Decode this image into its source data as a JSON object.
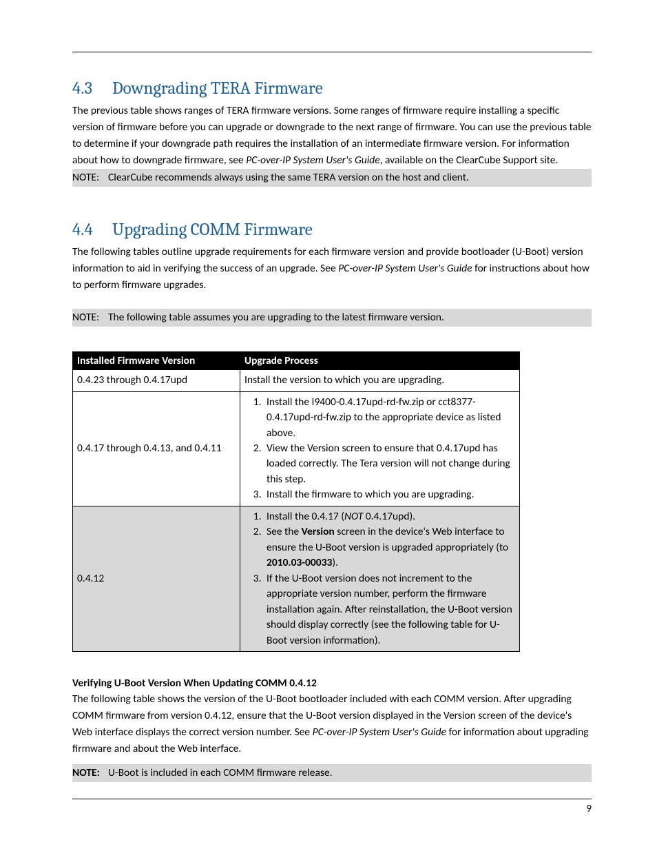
{
  "section43": {
    "num": "4.3",
    "title": "Downgrading TERA Firmware",
    "para_a": "The previous table shows ranges of TERA firmware versions. Some ranges of firmware require installing a specific version of firmware before you can upgrade or downgrade to the next range of firmware. You can use the previous table to determine if your downgrade path requires the installation of an intermediate firmware version. For information about how to downgrade firmware, see ",
    "para_a_italic": "PC-over-IP System User's Guide",
    "para_a_tail": ", available on the ClearCube Support site.",
    "note_label": "NOTE:",
    "note_text": "ClearCube recommends always using the same TERA version on the host and client."
  },
  "section44": {
    "num": "4.4",
    "title": "Upgrading COMM Firmware",
    "para_a": "The following tables outline upgrade requirements for each firmware version and provide bootloader (U-Boot) version information to aid in verifying the success of an upgrade. See ",
    "para_a_italic": "PC-over-IP System User's Guide",
    "para_a_tail": " for instructions about how to perform firmware upgrades.",
    "note_label": "NOTE:",
    "note_text": "The following table assumes you are upgrading to the latest firmware version."
  },
  "table": {
    "h1": "Installed Firmware Version",
    "h2": "Upgrade Process",
    "r1_ver": "0.4.23 through 0.4.17upd",
    "r1_proc": "Install the version to which you are upgrading.",
    "r2_ver": "0.4.17 through 0.4.13, and 0.4.11",
    "r2_s1": "Install the I9400-0.4.17upd-rd-fw.zip or cct8377-0.4.17upd-rd-fw.zip to the appropriate device as listed above.",
    "r2_s2": "View the Version screen to ensure that 0.4.17upd has loaded correctly.  The Tera version will not change during this step.",
    "r2_s3": "Install the firmware to which you are upgrading.",
    "r3_ver": "0.4.12",
    "r3_s1_a": "Install the 0.4.17 (",
    "r3_s1_i": "NOT",
    "r3_s1_b": " 0.4.17upd).",
    "r3_s2_a": "See the ",
    "r3_s2_b": "Version",
    "r3_s2_c": " screen in the device's Web interface to ensure the U-Boot version is upgraded appropriately (to ",
    "r3_s2_d": "2010.03-00033",
    "r3_s2_e": ").",
    "r3_s3": "If the U-Boot version does not increment to the appropriate version number, perform the firmware installation again. After reinstallation, the U-Boot version should display correctly (see the following table for U-Boot version information)."
  },
  "verify": {
    "heading": "Verifying U-Boot Version When Updating COMM 0.4.12",
    "para_a": "The following table shows the version of the U-Boot bootloader included with each COMM version. After upgrading COMM firmware from version 0.4.12, ensure that the U-Boot version displayed in the Version screen of the device's Web interface displays the correct version number. See ",
    "para_a_italic": "PC-over-IP System User's Guide",
    "para_a_tail": " for information about upgrading firmware and about the Web interface.",
    "note_label": "NOTE:",
    "note_text": "U-Boot is included in each COMM firmware release."
  },
  "page_number": "9"
}
